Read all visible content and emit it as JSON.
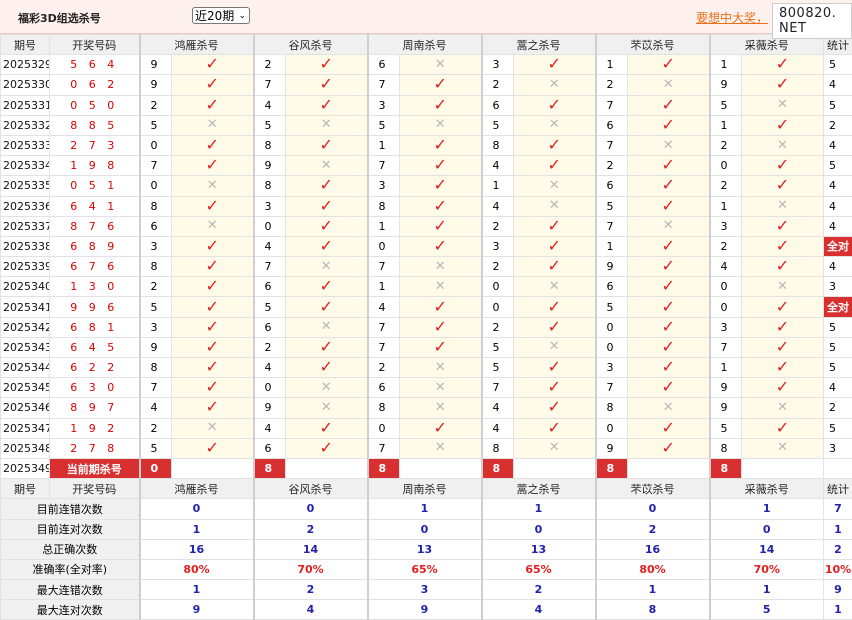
{
  "header": {
    "title": "福彩3D组选杀号",
    "period_selector": "近20期",
    "promo_text": "要想中大奖，",
    "site_badge": "800820. NET"
  },
  "columns": {
    "period": "期号",
    "draw": "开奖号码",
    "experts": [
      "鸿雁杀号",
      "谷风杀号",
      "周南杀号",
      "蒿之杀号",
      "芣苡杀号",
      "采薇杀号"
    ],
    "stat": "统计"
  },
  "rows": [
    {
      "period": "2025329",
      "draw": "5 6 4",
      "kills": [
        [
          "9",
          true
        ],
        [
          "2",
          true
        ],
        [
          "6",
          false
        ],
        [
          "3",
          true
        ],
        [
          "1",
          true
        ],
        [
          "1",
          true
        ]
      ],
      "stat": "5"
    },
    {
      "period": "2025330",
      "draw": "0 6 2",
      "kills": [
        [
          "9",
          true
        ],
        [
          "7",
          true
        ],
        [
          "7",
          true
        ],
        [
          "2",
          false
        ],
        [
          "2",
          false
        ],
        [
          "9",
          true
        ]
      ],
      "stat": "4"
    },
    {
      "period": "2025331",
      "draw": "0 5 0",
      "kills": [
        [
          "2",
          true
        ],
        [
          "4",
          true
        ],
        [
          "3",
          true
        ],
        [
          "6",
          true
        ],
        [
          "7",
          true
        ],
        [
          "5",
          false
        ]
      ],
      "stat": "5"
    },
    {
      "period": "2025332",
      "draw": "8 8 5",
      "kills": [
        [
          "5",
          false
        ],
        [
          "5",
          false
        ],
        [
          "5",
          false
        ],
        [
          "5",
          false
        ],
        [
          "6",
          true
        ],
        [
          "1",
          true
        ]
      ],
      "stat": "2"
    },
    {
      "period": "2025333",
      "draw": "2 7 3",
      "kills": [
        [
          "0",
          true
        ],
        [
          "8",
          true
        ],
        [
          "1",
          true
        ],
        [
          "8",
          true
        ],
        [
          "7",
          false
        ],
        [
          "2",
          false
        ]
      ],
      "stat": "4"
    },
    {
      "period": "2025334",
      "draw": "1 9 8",
      "kills": [
        [
          "7",
          true
        ],
        [
          "9",
          false
        ],
        [
          "7",
          true
        ],
        [
          "4",
          true
        ],
        [
          "2",
          true
        ],
        [
          "0",
          true
        ]
      ],
      "stat": "5"
    },
    {
      "period": "2025335",
      "draw": "0 5 1",
      "kills": [
        [
          "0",
          false
        ],
        [
          "8",
          true
        ],
        [
          "3",
          true
        ],
        [
          "1",
          false
        ],
        [
          "6",
          true
        ],
        [
          "2",
          true
        ]
      ],
      "stat": "4"
    },
    {
      "period": "2025336",
      "draw": "6 4 1",
      "kills": [
        [
          "8",
          true
        ],
        [
          "3",
          true
        ],
        [
          "8",
          true
        ],
        [
          "4",
          false
        ],
        [
          "5",
          true
        ],
        [
          "1",
          false
        ]
      ],
      "stat": "4"
    },
    {
      "period": "2025337",
      "draw": "8 7 6",
      "kills": [
        [
          "6",
          false
        ],
        [
          "0",
          true
        ],
        [
          "1",
          true
        ],
        [
          "2",
          true
        ],
        [
          "7",
          false
        ],
        [
          "3",
          true
        ]
      ],
      "stat": "4"
    },
    {
      "period": "2025338",
      "draw": "6 8 9",
      "kills": [
        [
          "3",
          true
        ],
        [
          "4",
          true
        ],
        [
          "0",
          true
        ],
        [
          "3",
          true
        ],
        [
          "1",
          true
        ],
        [
          "2",
          true
        ]
      ],
      "stat": "全对"
    },
    {
      "period": "2025339",
      "draw": "6 7 6",
      "kills": [
        [
          "8",
          true
        ],
        [
          "7",
          false
        ],
        [
          "7",
          false
        ],
        [
          "2",
          true
        ],
        [
          "9",
          true
        ],
        [
          "4",
          true
        ]
      ],
      "stat": "4"
    },
    {
      "period": "2025340",
      "draw": "1 3 0",
      "kills": [
        [
          "2",
          true
        ],
        [
          "6",
          true
        ],
        [
          "1",
          false
        ],
        [
          "0",
          false
        ],
        [
          "6",
          true
        ],
        [
          "0",
          false
        ]
      ],
      "stat": "3"
    },
    {
      "period": "2025341",
      "draw": "9 9 6",
      "kills": [
        [
          "5",
          true
        ],
        [
          "5",
          true
        ],
        [
          "4",
          true
        ],
        [
          "0",
          true
        ],
        [
          "5",
          true
        ],
        [
          "0",
          true
        ]
      ],
      "stat": "全对"
    },
    {
      "period": "2025342",
      "draw": "6 8 1",
      "kills": [
        [
          "3",
          true
        ],
        [
          "6",
          false
        ],
        [
          "7",
          true
        ],
        [
          "2",
          true
        ],
        [
          "0",
          true
        ],
        [
          "3",
          true
        ]
      ],
      "stat": "5"
    },
    {
      "period": "2025343",
      "draw": "6 4 5",
      "kills": [
        [
          "9",
          true
        ],
        [
          "2",
          true
        ],
        [
          "7",
          true
        ],
        [
          "5",
          false
        ],
        [
          "0",
          true
        ],
        [
          "7",
          true
        ]
      ],
      "stat": "5"
    },
    {
      "period": "2025344",
      "draw": "6 2 2",
      "kills": [
        [
          "8",
          true
        ],
        [
          "4",
          true
        ],
        [
          "2",
          false
        ],
        [
          "5",
          true
        ],
        [
          "3",
          true
        ],
        [
          "1",
          true
        ]
      ],
      "stat": "5"
    },
    {
      "period": "2025345",
      "draw": "6 3 0",
      "kills": [
        [
          "7",
          true
        ],
        [
          "0",
          false
        ],
        [
          "6",
          false
        ],
        [
          "7",
          true
        ],
        [
          "7",
          true
        ],
        [
          "9",
          true
        ]
      ],
      "stat": "4"
    },
    {
      "period": "2025346",
      "draw": "8 9 7",
      "kills": [
        [
          "4",
          true
        ],
        [
          "9",
          false
        ],
        [
          "8",
          false
        ],
        [
          "4",
          true
        ],
        [
          "8",
          false
        ],
        [
          "9",
          false
        ]
      ],
      "stat": "2"
    },
    {
      "period": "2025347",
      "draw": "1 9 2",
      "kills": [
        [
          "2",
          false
        ],
        [
          "4",
          true
        ],
        [
          "0",
          true
        ],
        [
          "4",
          true
        ],
        [
          "0",
          true
        ],
        [
          "5",
          true
        ]
      ],
      "stat": "5"
    },
    {
      "period": "2025348",
      "draw": "2 7 8",
      "kills": [
        [
          "5",
          true
        ],
        [
          "6",
          true
        ],
        [
          "7",
          false
        ],
        [
          "8",
          false
        ],
        [
          "9",
          true
        ],
        [
          "8",
          false
        ]
      ],
      "stat": "3"
    }
  ],
  "current": {
    "period": "2025349",
    "label": "当前期杀号",
    "kills": [
      "0",
      "8",
      "8",
      "8",
      "8",
      "8"
    ]
  },
  "summary": [
    {
      "label": "目前连错次数",
      "values": [
        "0",
        "0",
        "1",
        "1",
        "0",
        "1"
      ],
      "stat": "7",
      "red": false
    },
    {
      "label": "目前连对次数",
      "values": [
        "1",
        "2",
        "0",
        "0",
        "2",
        "0"
      ],
      "stat": "1",
      "red": false
    },
    {
      "label": "总正确次数",
      "values": [
        "16",
        "14",
        "13",
        "13",
        "16",
        "14"
      ],
      "stat": "2",
      "red": false
    },
    {
      "label": "准确率(全对率)",
      "values": [
        "80%",
        "70%",
        "65%",
        "65%",
        "80%",
        "70%"
      ],
      "stat": "10%",
      "red": true
    },
    {
      "label": "最大连错次数",
      "values": [
        "1",
        "2",
        "3",
        "2",
        "1",
        "1"
      ],
      "stat": "9",
      "red": false
    },
    {
      "label": "最大连对次数",
      "values": [
        "9",
        "4",
        "9",
        "4",
        "8",
        "5"
      ],
      "stat": "1",
      "red": false
    }
  ],
  "marks": {
    "correct": "✓",
    "wrong": "✕"
  },
  "colors": {
    "correct": "#e02020",
    "wrong": "#b8b8b8",
    "highlight": "#d83030",
    "value_blue": "#2222aa"
  }
}
